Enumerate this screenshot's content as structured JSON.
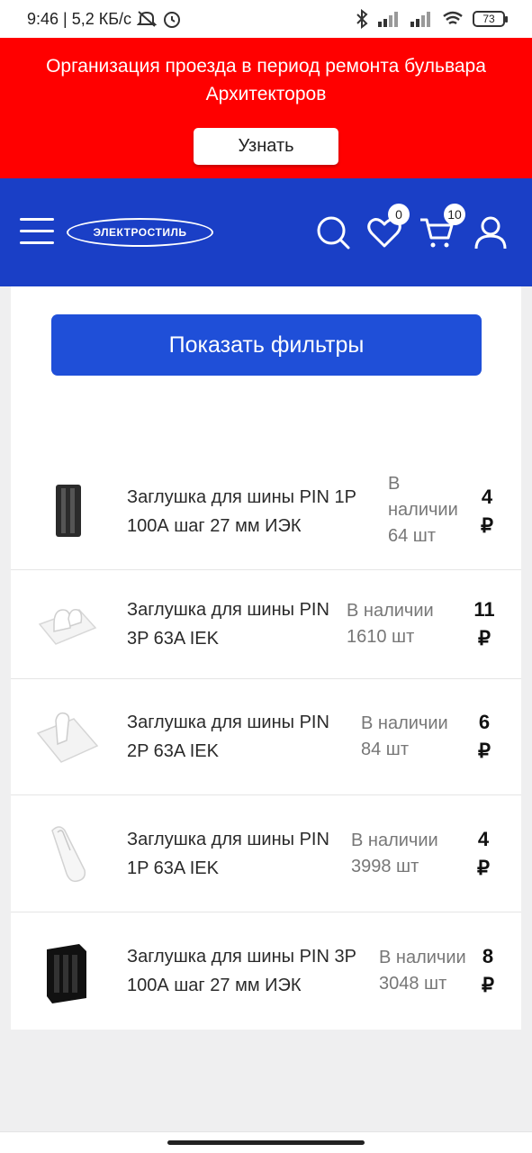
{
  "status_bar": {
    "time_speed": "9:46 | 5,2 КБ/с",
    "battery": "73"
  },
  "promo": {
    "text": "Организация проезда в период ремонта бульвара Архитекторов",
    "button": "Узнать"
  },
  "header": {
    "logo": "ЭЛЕКТРОСТИЛЬ",
    "favorites_count": "0",
    "cart_count": "10",
    "icons": [
      "menu-icon",
      "search-icon",
      "heart-icon",
      "cart-icon",
      "user-icon"
    ]
  },
  "filters_button": "Показать фильтры",
  "products": [
    {
      "name": "Заглушка для шины PIN 1Р 100А шаг 27 мм ИЭК",
      "stock": "В наличии 64 шт",
      "price": "4 ₽"
    },
    {
      "name": "Заглушка для шины PIN 3P 63A IEK",
      "stock": "В наличии 1610 шт",
      "price": "11 ₽"
    },
    {
      "name": "Заглушка для шины PIN 2P 63A IEK",
      "stock": "В наличии 84 шт",
      "price": "6 ₽"
    },
    {
      "name": "Заглушка для шины PIN 1P 63A IEK",
      "stock": "В наличии 3998 шт",
      "price": "4 ₽"
    },
    {
      "name": "Заглушка для шины PIN 3Р 100А шаг 27 мм ИЭК",
      "stock": "В наличии 3048 шт",
      "price": "8 ₽"
    }
  ],
  "colors": {
    "promo_bg": "#ff0000",
    "header_bg": "#1a3fc6",
    "button_bg": "#1f4fd8"
  }
}
